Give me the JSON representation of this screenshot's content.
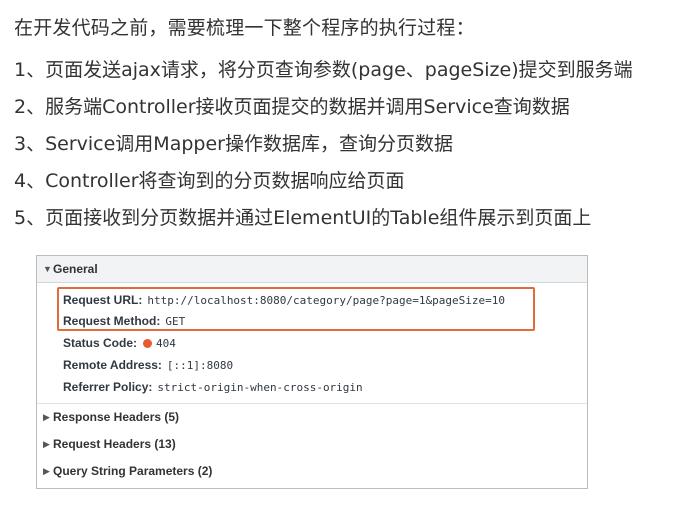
{
  "intro": "在开发代码之前，需要梳理一下整个程序的执行过程：",
  "steps": [
    "1、页面发送ajax请求，将分页查询参数(page、pageSize)提交到服务端",
    "2、服务端Controller接收页面提交的数据并调用Service查询数据",
    "3、Service调用Mapper操作数据库，查询分页数据",
    "4、Controller将查询到的分页数据响应给页面",
    "5、页面接收到分页数据并通过ElementUI的Table组件展示到页面上"
  ],
  "devtools": {
    "general": {
      "title": "General",
      "request_url_label": "Request URL:",
      "request_url": "http://localhost:8080/category/page?page=1&pageSize=10",
      "request_method_label": "Request Method:",
      "request_method": "GET",
      "status_code_label": "Status Code:",
      "status_code": "404",
      "status_color": "#e8592c",
      "remote_address_label": "Remote Address:",
      "remote_address": "[::1]:8080",
      "referrer_policy_label": "Referrer Policy:",
      "referrer_policy": "strict-origin-when-cross-origin"
    },
    "highlight_color": "#e26a3b",
    "response_headers": "Response Headers (5)",
    "request_headers": "Request Headers (13)",
    "query_string_params": "Query String Parameters (2)"
  }
}
